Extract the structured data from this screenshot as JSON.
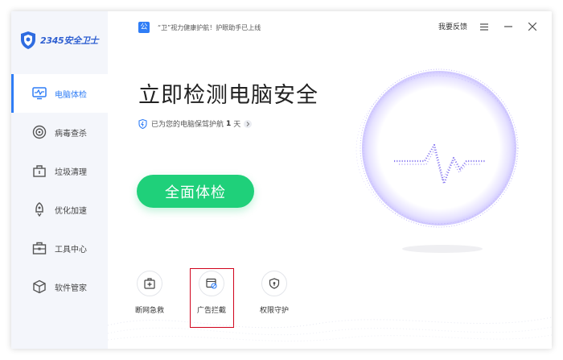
{
  "app": {
    "logo_text": "2345安全卫士"
  },
  "notice": {
    "badge": "公",
    "text": "“卫”视力健康护航！护眼助手已上线"
  },
  "topbar": {
    "feedback_label": "我要反馈"
  },
  "sidebar": {
    "items": [
      {
        "label": "电脑体检",
        "icon": "monitor-icon",
        "active": true
      },
      {
        "label": "病毒查杀",
        "icon": "target-icon",
        "active": false
      },
      {
        "label": "垃圾清理",
        "icon": "trash-icon",
        "active": false
      },
      {
        "label": "优化加速",
        "icon": "rocket-icon",
        "active": false
      },
      {
        "label": "工具中心",
        "icon": "toolbox-icon",
        "active": false
      },
      {
        "label": "软件管家",
        "icon": "package-icon",
        "active": false
      }
    ]
  },
  "main": {
    "headline": "立即检测电脑安全",
    "protect_prefix": "已为您的电脑保驾护航",
    "protect_days": "1",
    "protect_unit": "天",
    "scan_button": "全面体检"
  },
  "tools": [
    {
      "label": "断网急救",
      "icon": "first-aid-icon"
    },
    {
      "label": "广告拦截",
      "icon": "ad-block-icon",
      "highlighted": true
    },
    {
      "label": "权限守护",
      "icon": "shield-icon"
    }
  ],
  "colors": {
    "accent": "#2f7df6",
    "scan_button": "#1fd07a",
    "highlight": "#d0021b",
    "orb": "#8b7cf0"
  }
}
